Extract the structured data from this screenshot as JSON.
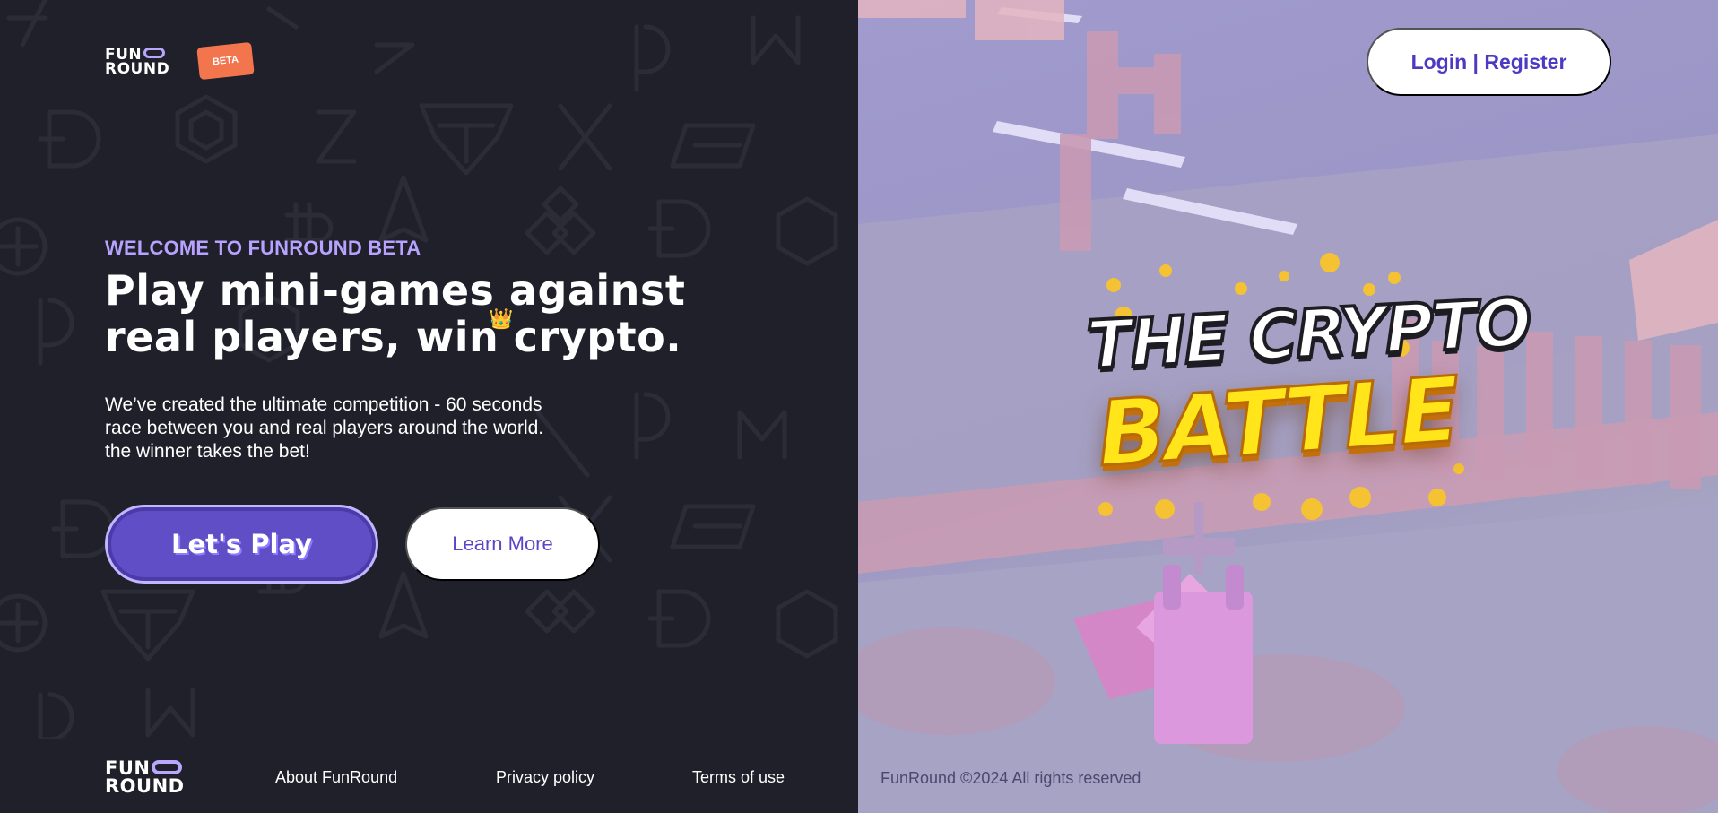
{
  "header": {
    "logo_line1": "FUN",
    "logo_line2": "ROUND",
    "beta_badge": "BETA",
    "login_label": "Login | Register"
  },
  "hero": {
    "welcome": "WELCOME TO FUNROUND BETA",
    "headline_line1": "Play mini-games against",
    "headline_line2": "real players, win crypto.",
    "description_line1": "We’ve created the ultimate competition - 60 seconds",
    "description_line2": "race between you and real players around the world.",
    "description_line3": "the winner takes the bet!",
    "play_label": "Let's Play",
    "learn_label": "Learn More"
  },
  "game_logo": {
    "line1": "THE CRYPTO",
    "line2": "BATTLE"
  },
  "footer": {
    "logo_line1": "FUN",
    "logo_line2": "ROUND",
    "links": [
      "About FunRound",
      "Privacy policy",
      "Terms of use"
    ],
    "copyright": "FunRound ©2024 All rights reserved"
  },
  "colors": {
    "dark_background": "#1f2029",
    "accent_purple": "#5f4ec5",
    "accent_lavender": "#b8a2ff",
    "beta_orange": "#f2754d",
    "title_yellow": "#ffe51a"
  }
}
